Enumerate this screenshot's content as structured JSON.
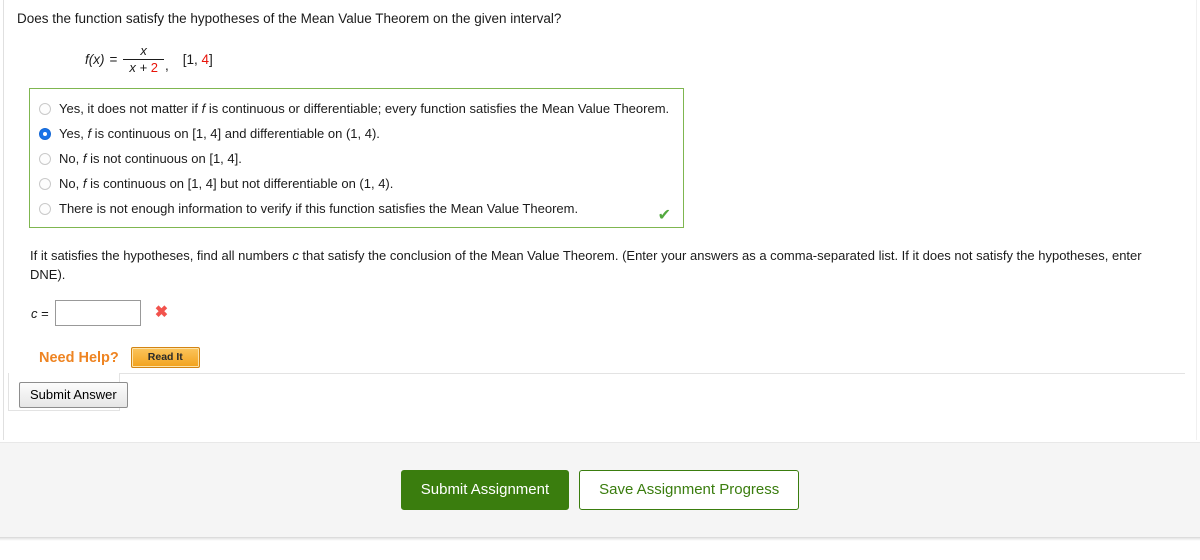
{
  "question": {
    "prompt": "Does the function satisfy the hypotheses of the Mean Value Theorem on the given interval?",
    "formula": {
      "fx": "f(x)",
      "equals": "=",
      "numerator": "x",
      "denominator_left": "x + ",
      "denominator_red": "2",
      "comma": ",",
      "interval_open": "[1, ",
      "interval_red": "4",
      "interval_close": "]"
    }
  },
  "choices": [
    {
      "id": "choice-1",
      "text": "Yes, it does not matter if f is continuous or differentiable; every function satisfies the Mean Value Theorem.",
      "selected": false
    },
    {
      "id": "choice-2",
      "text": "Yes, f is continuous on [1, 4] and differentiable on (1, 4).",
      "selected": true
    },
    {
      "id": "choice-3",
      "text": "No, f is not continuous on [1, 4].",
      "selected": false
    },
    {
      "id": "choice-4",
      "text": "No, f is continuous on [1, 4] but not differentiable on (1, 4).",
      "selected": false
    },
    {
      "id": "choice-5",
      "text": "There is not enough information to verify if this function satisfies the Mean Value Theorem.",
      "selected": false
    }
  ],
  "choices_status": {
    "icon": "check-mark-icon",
    "glyph": "✔",
    "color": "#53a93f"
  },
  "instruction": "If it satisfies the hypotheses, find all numbers c that satisfy the conclusion of the Mean Value Theorem. (Enter your answers as a comma-separated list. If it does not satisfy the hypotheses, enter DNE).",
  "answer": {
    "label": "c",
    "equals": "=",
    "value": "",
    "placeholder": "",
    "status_icon": "x-mark-icon",
    "status_glyph": "✖",
    "status_color": "#f2534d"
  },
  "help": {
    "label": "Need Help?",
    "label_color": "#ee8422",
    "read_it_label": "Read It"
  },
  "submit": {
    "answer_label": "Submit Answer"
  },
  "footer": {
    "submit_assignment_label": "Submit Assignment",
    "save_progress_label": "Save Assignment Progress",
    "primary_color": "#3a7d0e"
  }
}
